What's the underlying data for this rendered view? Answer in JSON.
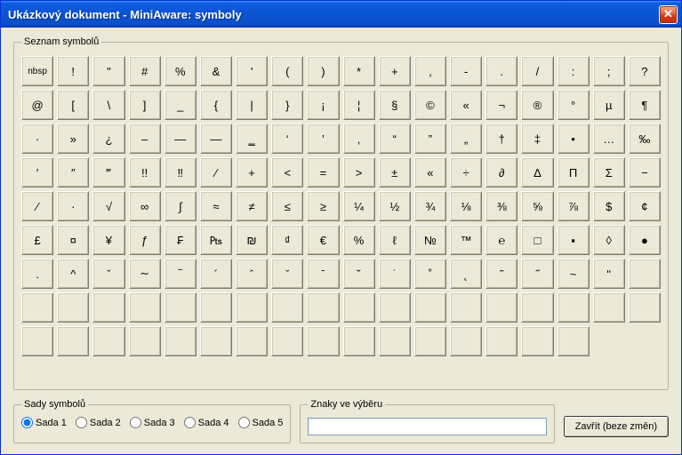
{
  "window": {
    "title": "Ukázkový dokument - MiniAware: symboly"
  },
  "symbols": {
    "legend": "Seznam symbolů",
    "cells": [
      "nbsp",
      "!",
      "\"",
      "#",
      "%",
      "&",
      "'",
      "(",
      ")",
      "*",
      "+",
      ",",
      "-",
      ".",
      "/",
      ":",
      ";",
      "?",
      "@",
      "[",
      "\\",
      "]",
      "_",
      "{",
      "|",
      "}",
      "¡",
      "¦",
      "§",
      "©",
      "«",
      "¬",
      "®",
      "°",
      "µ",
      "¶",
      "·",
      "»",
      "¿",
      "–",
      "—",
      "―",
      "‗",
      "‘",
      "’",
      "‚",
      "“",
      "”",
      "„",
      "†",
      "‡",
      "•",
      "…",
      "‰",
      "′",
      "″",
      "‴",
      "!!",
      "‼",
      "⁄",
      "+",
      "<",
      "=",
      ">",
      "±",
      "«",
      "÷",
      "∂",
      "Δ",
      "Π",
      "Σ",
      "−",
      "∕",
      "·",
      "√",
      "∞",
      "∫",
      "≈",
      "≠",
      "≤",
      "≥",
      "¼",
      "½",
      "¾",
      "⅛",
      "⅜",
      "⅝",
      "⅞",
      "$",
      "¢",
      "£",
      "¤",
      "¥",
      "ƒ",
      "₣",
      "₧",
      "₪",
      "₫",
      "€",
      "%",
      "ℓ",
      "№",
      "™",
      "℮",
      "□",
      "▪",
      "◊",
      "●",
      ".",
      "^",
      "ˇ",
      "∼",
      "‾",
      "´",
      "ˆ",
      "ˇ",
      "ˉ",
      "˘",
      "˙",
      "˚",
      "˛",
      "˜",
      "˝",
      "~",
      "ʺ",
      "",
      "",
      "",
      "",
      "",
      "",
      "",
      "",
      "",
      "",
      "",
      "",
      "",
      "",
      "",
      "",
      "",
      "",
      "",
      "",
      "",
      "",
      "",
      "",
      "",
      "",
      "",
      "",
      "",
      "",
      "",
      "",
      "",
      "",
      ""
    ]
  },
  "sets": {
    "legend": "Sady symbolů",
    "options": [
      {
        "label": "Sada 1",
        "checked": true
      },
      {
        "label": "Sada 2",
        "checked": false
      },
      {
        "label": "Sada 3",
        "checked": false
      },
      {
        "label": "Sada 4",
        "checked": false
      },
      {
        "label": "Sada 5",
        "checked": false
      }
    ]
  },
  "selection": {
    "legend": "Znaky ve výběru",
    "value": ""
  },
  "buttons": {
    "close": "Zavřít (beze změn)"
  }
}
